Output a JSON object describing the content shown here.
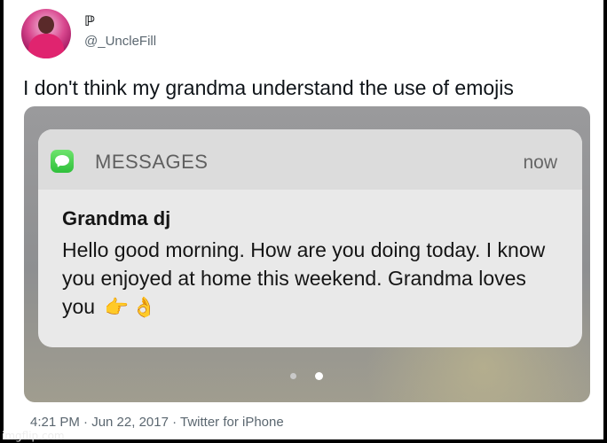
{
  "tweet": {
    "display_name": "ℙ",
    "handle": "@_UncleFill",
    "text": "I don't think my grandma understand the use of emojis",
    "meta": "4:21 PM · Jun 22, 2017 · Twitter for iPhone",
    "avatar_icon": "avatar-photo"
  },
  "notification": {
    "app_name": "MESSAGES",
    "app_icon": "messages-icon",
    "app_icon_color": "#34c759",
    "time": "now",
    "sender": "Grandma dj",
    "message": "Hello good morning. How are you doing today. I know you enjoyed at home this weekend. Grandma  loves you",
    "emojis": [
      "👉",
      "👌"
    ],
    "page_dots": 2,
    "active_dot": 2
  },
  "watermark": "imgflip.com"
}
